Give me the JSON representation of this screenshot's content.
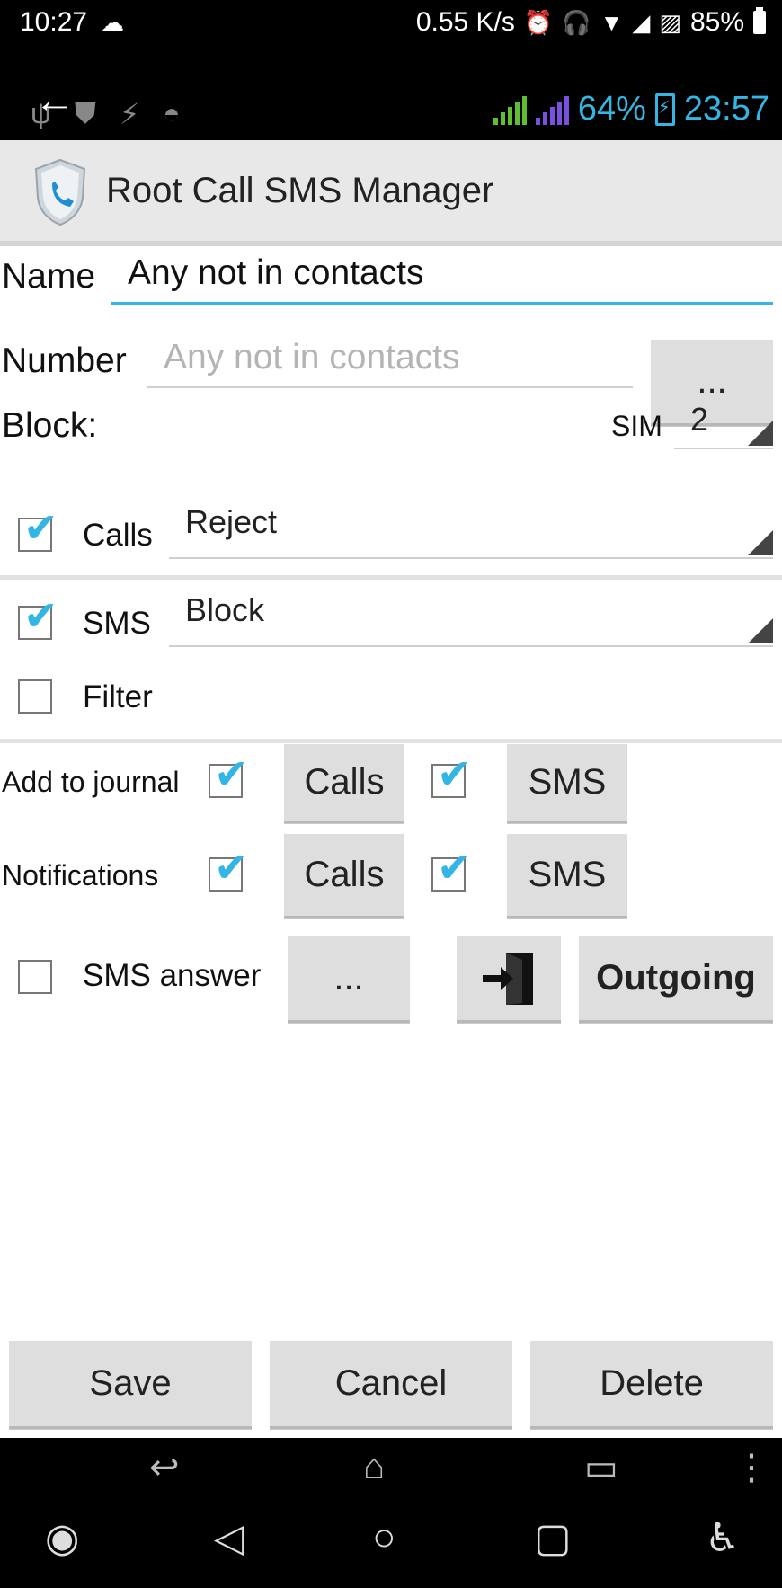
{
  "system_status": {
    "time": "10:27",
    "speed": "0.55 K/s",
    "battery": "85%"
  },
  "inner_status": {
    "battery": "64%",
    "time": "23:57"
  },
  "app": {
    "title": "Root Call SMS Manager"
  },
  "form": {
    "name_label": "Name",
    "name_value": "Any not in contacts",
    "number_label": "Number",
    "number_placeholder": "Any not in contacts",
    "number_button": "...",
    "block_label": "Block:",
    "sim_label": "SIM",
    "sim_value": "2",
    "calls_label": "Calls",
    "calls_action": "Reject",
    "sms_label": "SMS",
    "sms_action": "Block",
    "filter_label": "Filter",
    "journal_label": "Add to journal",
    "journal_calls_button": "Calls",
    "journal_sms_button": "SMS",
    "notifications_label": "Notifications",
    "notifications_calls_button": "Calls",
    "notifications_sms_button": "SMS",
    "sms_answer_label": "SMS answer",
    "sms_answer_button": "...",
    "outgoing_button": "Outgoing"
  },
  "checkboxes": {
    "calls": true,
    "sms": true,
    "filter": false,
    "journal_calls": true,
    "journal_sms": true,
    "notifications_calls": true,
    "notifications_sms": true,
    "sms_answer": false
  },
  "footer": {
    "save": "Save",
    "cancel": "Cancel",
    "delete": "Delete"
  },
  "colors": {
    "accent": "#33b5e5",
    "button_bg": "#dedede"
  }
}
